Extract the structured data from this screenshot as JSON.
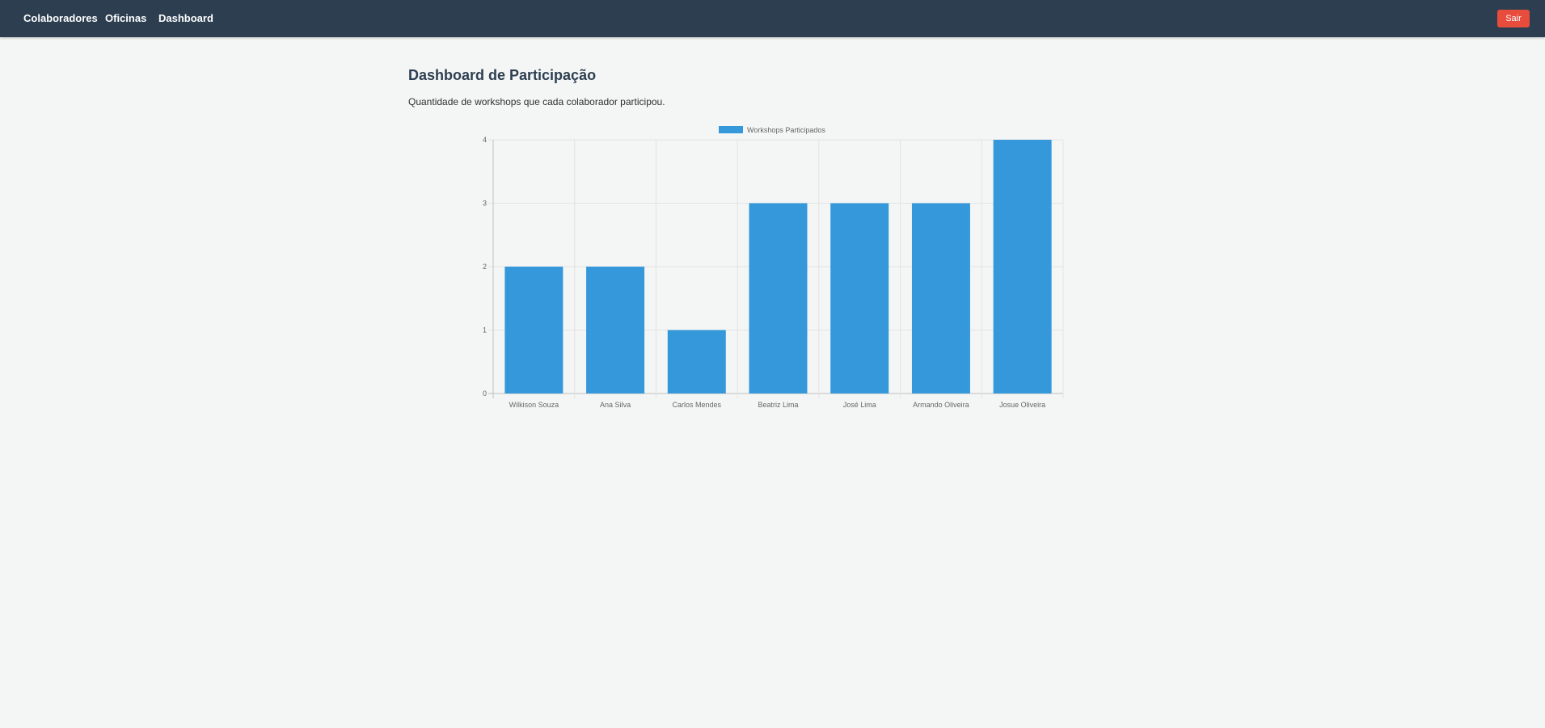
{
  "nav": {
    "links": [
      "Colaboradores",
      "Oficinas",
      "Dashboard"
    ],
    "logout_label": "Sair"
  },
  "page": {
    "title": "Dashboard de Participação",
    "subtitle": "Quantidade de workshops que cada colaborador participou."
  },
  "colors": {
    "navbar": "#2c3e50",
    "logout": "#e74c3c",
    "bar": "#3498db"
  },
  "chart_data": {
    "type": "bar",
    "categories": [
      "Wilkison Souza",
      "Ana Silva",
      "Carlos Mendes",
      "Beatriz Lima",
      "José Lima",
      "Armando Oliveira",
      "Josue Oliveira"
    ],
    "series": [
      {
        "name": "Workshops Participados",
        "values": [
          2,
          2,
          1,
          3,
          3,
          3,
          4
        ]
      }
    ],
    "yticks": [
      0,
      1,
      2,
      3,
      4
    ],
    "ylim": [
      0,
      4
    ],
    "grid": true,
    "legend": "top-center"
  }
}
